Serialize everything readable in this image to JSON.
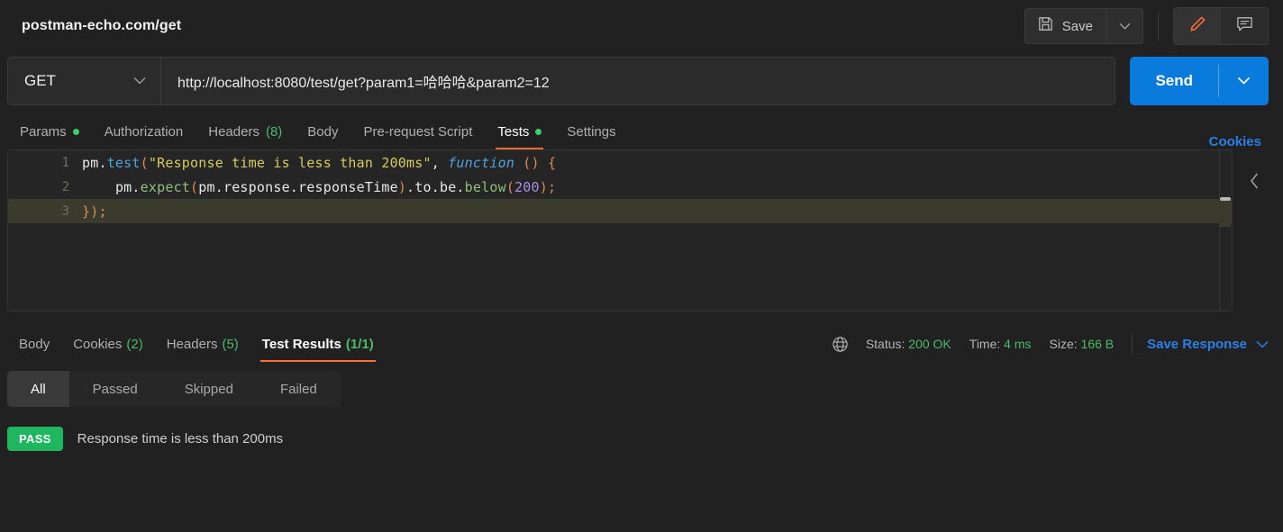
{
  "header": {
    "request_title": "postman-echo.com/get",
    "save_label": "Save",
    "save_icon": "floppy-disk-icon",
    "save_caret_icon": "chevron-down-icon",
    "edit_icon": "pencil-icon",
    "comment_icon": "comment-icon",
    "accent_orange": "#ff6c37"
  },
  "url_bar": {
    "method": "GET",
    "method_caret_icon": "chevron-down-icon",
    "url": "http://localhost:8080/test/get?param1=哈哈哈&param2=12",
    "send_label": "Send",
    "send_caret_icon": "chevron-down-icon",
    "send_color": "#0a7bdc"
  },
  "request_tabs": {
    "items": [
      {
        "label": "Params",
        "dot": true,
        "count": "",
        "active": false
      },
      {
        "label": "Authorization",
        "dot": false,
        "count": "",
        "active": false
      },
      {
        "label": "Headers",
        "dot": false,
        "count": "(8)",
        "active": false
      },
      {
        "label": "Body",
        "dot": false,
        "count": "",
        "active": false
      },
      {
        "label": "Pre-request Script",
        "dot": false,
        "count": "",
        "active": false
      },
      {
        "label": "Tests",
        "dot": true,
        "count": "",
        "active": true
      },
      {
        "label": "Settings",
        "dot": false,
        "count": "",
        "active": false
      }
    ],
    "cookies_link": "Cookies"
  },
  "editor": {
    "collapse_icon": "chevron-left-icon",
    "lines": [
      {
        "num": "1",
        "highlighted": false
      },
      {
        "num": "2",
        "highlighted": false
      },
      {
        "num": "3",
        "highlighted": true
      }
    ],
    "code": {
      "l1_pm": "pm",
      "l1_dot": ".",
      "l1_test": "test",
      "l1_paren": "(",
      "l1_string": "\"Response time is less than 200ms\"",
      "l1_comma": ", ",
      "l1_function": "function",
      "l1_args": " () {",
      "l2_indent": "    ",
      "l2_pm": "pm",
      "l2_dot1": ".",
      "l2_expect": "expect",
      "l2_open": "(",
      "l2_chain": "pm.response.responseTime",
      "l2_close": ")",
      "l2_to_be": ".to.be.",
      "l2_below": "below",
      "l2_open2": "(",
      "l2_num": "200",
      "l2_end": ");",
      "l3": "});"
    }
  },
  "response": {
    "tabs": [
      {
        "label": "Body",
        "count": "",
        "active": false
      },
      {
        "label": "Cookies",
        "count": "(2)",
        "active": false
      },
      {
        "label": "Headers",
        "count": "(5)",
        "active": false
      },
      {
        "label": "Test Results",
        "count": "(1/1)",
        "active": true
      }
    ],
    "globe_icon": "globe-icon",
    "status_label": "Status:",
    "status_value": "200 OK",
    "time_label": "Time:",
    "time_value": "4 ms",
    "size_label": "Size:",
    "size_value": "166 B",
    "save_response_label": "Save Response",
    "save_response_caret_icon": "chevron-down-icon"
  },
  "filters": {
    "items": [
      {
        "label": "All",
        "active": true
      },
      {
        "label": "Passed",
        "active": false
      },
      {
        "label": "Skipped",
        "active": false
      },
      {
        "label": "Failed",
        "active": false
      }
    ]
  },
  "test_results": {
    "rows": [
      {
        "status": "PASS",
        "name": "Response time is less than 200ms"
      }
    ]
  }
}
